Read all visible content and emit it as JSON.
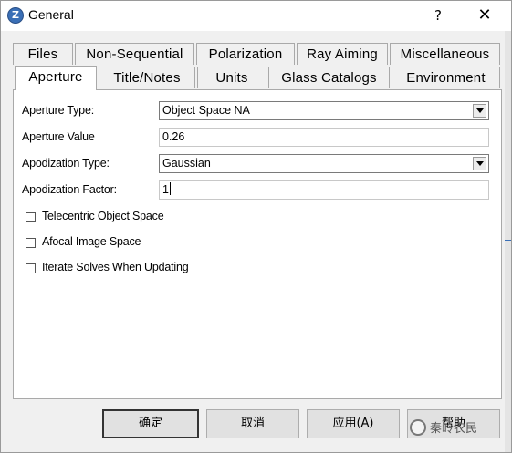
{
  "window": {
    "title": "General",
    "help_label": "?",
    "close_label": "✕",
    "app_icon_letter": "Z"
  },
  "tabs": {
    "row_back": [
      "Files",
      "Non-Sequential",
      "Polarization",
      "Ray Aiming",
      "Miscellaneous"
    ],
    "row_front": [
      "Aperture",
      "Title/Notes",
      "Units",
      "Glass Catalogs",
      "Environment"
    ],
    "active": "Aperture"
  },
  "form": {
    "aperture_type_label": "Aperture Type:",
    "aperture_type_value": "Object Space NA",
    "aperture_value_label": "Aperture Value",
    "aperture_value_value": "0.26",
    "apodization_type_label": "Apodization Type:",
    "apodization_type_value": "Gaussian",
    "apodization_factor_label": "Apodization Factor:",
    "apodization_factor_value": "1"
  },
  "checkboxes": [
    {
      "label": "Telecentric Object Space",
      "checked": false
    },
    {
      "label": "Afocal Image Space",
      "checked": false
    },
    {
      "label": "Iterate Solves When Updating",
      "checked": false
    }
  ],
  "buttons": {
    "ok": "确定",
    "cancel": "取消",
    "apply": "应用(A)",
    "help": "帮助"
  },
  "watermark": {
    "text": "秦岭农民"
  }
}
